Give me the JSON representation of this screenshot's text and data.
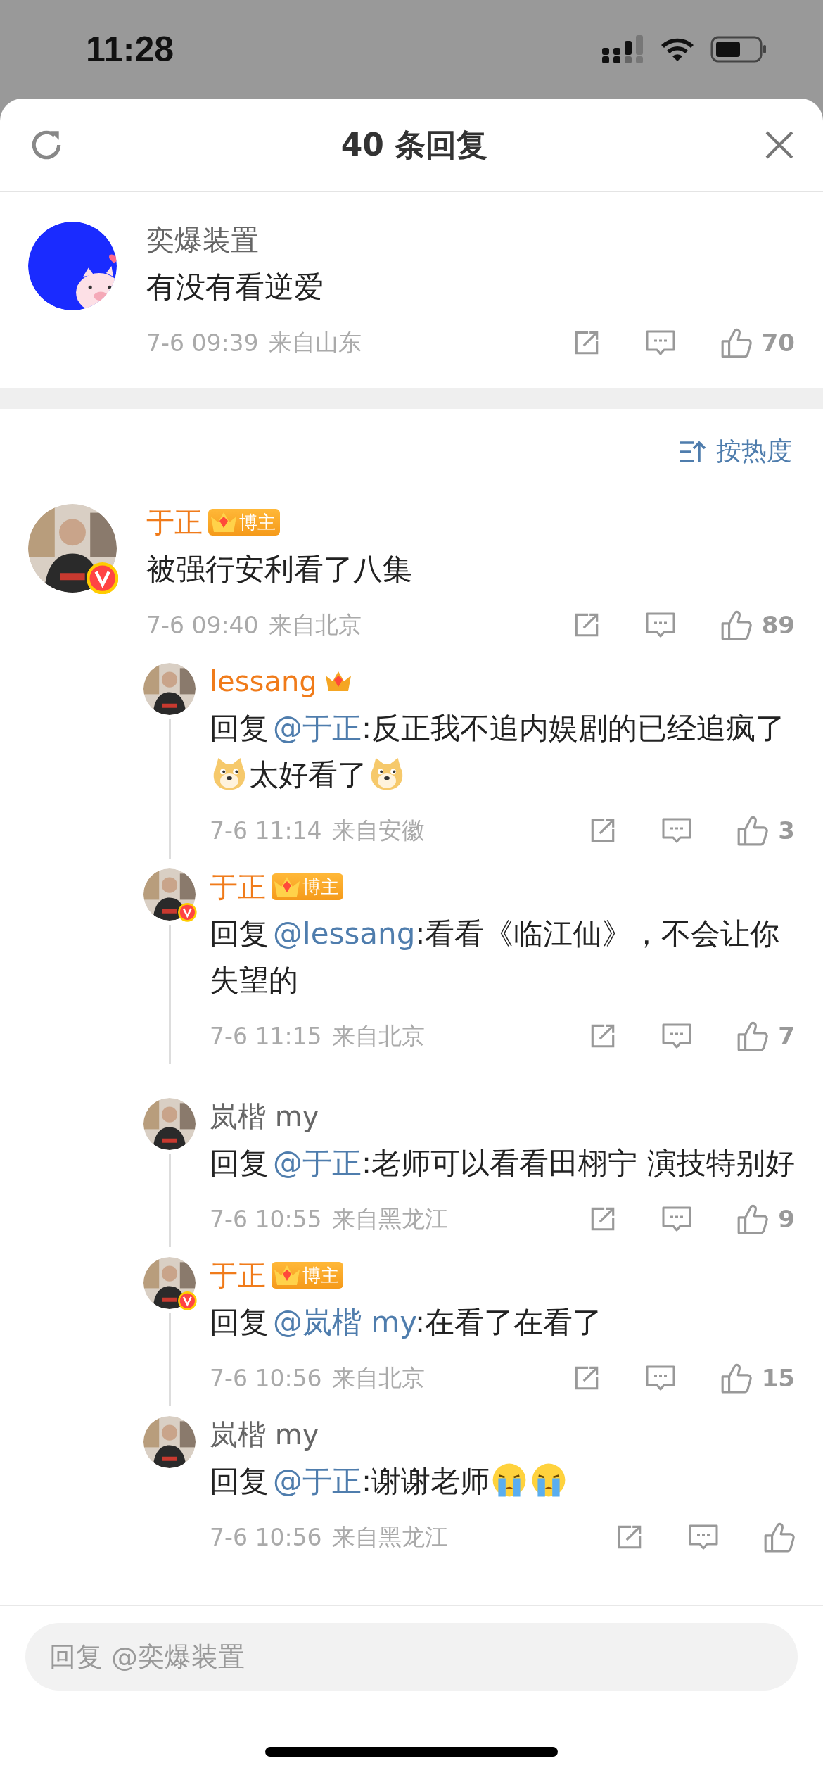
{
  "status_bar": {
    "time": "11:28"
  },
  "header": {
    "title": "40 条回复"
  },
  "root_comment": {
    "user": "奕爆装置",
    "avatar": {
      "kind": "cartoon"
    },
    "vip": false,
    "verified": false,
    "text": [
      {
        "kind": "text",
        "text": "有没有看逆爱"
      }
    ],
    "time": "7-6 09:39",
    "location": "来自山东",
    "likes": "70"
  },
  "sort": {
    "label": "按热度"
  },
  "comment": {
    "user": "于正",
    "avatar": {
      "kind": "picture"
    },
    "vip": true,
    "badge": "博主",
    "verified": true,
    "text": [
      {
        "kind": "text",
        "text": "被强行安利看了八集"
      }
    ],
    "time": "7-6 09:40",
    "location": "来自北京",
    "likes": "89"
  },
  "replies": [
    {
      "user": "lessang",
      "avatar": {
        "kind": "picture"
      },
      "vip": true,
      "verified": false,
      "text": [
        {
          "kind": "text",
          "text": "回复"
        },
        {
          "kind": "mention",
          "text": "@于正"
        },
        {
          "kind": "text",
          "text": ":反正我不追内娱剧的已经追疯了"
        },
        {
          "kind": "doge"
        },
        {
          "kind": "text",
          "text": "太好看了"
        },
        {
          "kind": "doge"
        }
      ],
      "time": "7-6 11:14",
      "location": "来自安徽",
      "likes": "3"
    },
    {
      "user": "于正",
      "avatar": {
        "kind": "picture"
      },
      "vip": true,
      "badge": "博主",
      "verified": true,
      "text": [
        {
          "kind": "text",
          "text": "回复"
        },
        {
          "kind": "mention",
          "text": "@lessang"
        },
        {
          "kind": "text",
          "text": ":看看《临江仙》，不会让你失望的"
        }
      ],
      "time": "7-6 11:15",
      "location": "来自北京",
      "likes": "7"
    },
    {
      "user": "岚楷 my",
      "avatar": {
        "kind": "picture"
      },
      "vip": false,
      "verified": false,
      "text": [
        {
          "kind": "text",
          "text": "回复"
        },
        {
          "kind": "mention",
          "text": "@于正"
        },
        {
          "kind": "text",
          "text": ":老师可以看看田栩宁 演技特别好"
        }
      ],
      "time": "7-6 10:55",
      "location": "来自黑龙江",
      "likes": "9"
    },
    {
      "user": "于正",
      "avatar": {
        "kind": "picture"
      },
      "vip": true,
      "badge": "博主",
      "verified": true,
      "text": [
        {
          "kind": "text",
          "text": "回复"
        },
        {
          "kind": "mention",
          "text": "@岚楷 my"
        },
        {
          "kind": "text",
          "text": ":在看了在看了"
        }
      ],
      "time": "7-6 10:56",
      "location": "来自北京",
      "likes": "15"
    },
    {
      "user": "岚楷 my",
      "avatar": {
        "kind": "picture"
      },
      "vip": false,
      "verified": false,
      "text": [
        {
          "kind": "text",
          "text": "回复"
        },
        {
          "kind": "mention",
          "text": "@于正"
        },
        {
          "kind": "text",
          "text": ":谢谢老师"
        },
        {
          "kind": "cry"
        },
        {
          "kind": "cry"
        }
      ],
      "time": "7-6 10:56",
      "location": "来自黑龙江"
    }
  ],
  "reply_field": {
    "placeholder": "回复 @奕爆装置"
  }
}
